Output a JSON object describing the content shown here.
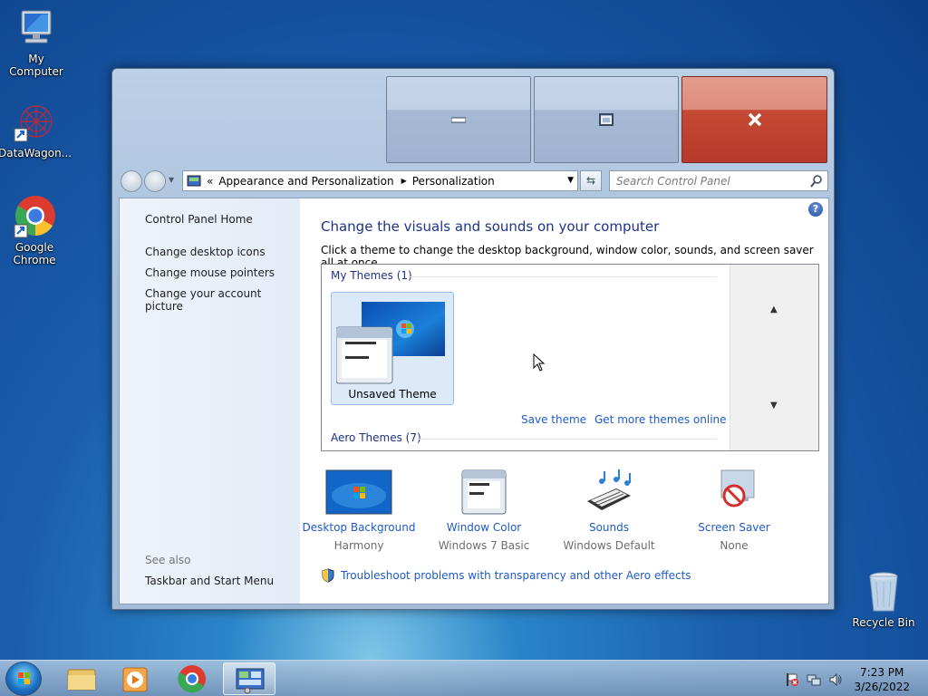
{
  "desktop": {
    "icons": [
      {
        "label": "My Computer"
      },
      {
        "label": "DataWagon..."
      },
      {
        "label": "Google Chrome"
      },
      {
        "label": "Recycle Bin"
      }
    ]
  },
  "window": {
    "caption_buttons": {
      "minimize": "minimize",
      "maximize": "maximize",
      "close": "close"
    },
    "address": {
      "overflow": "«",
      "crumbs": [
        "Appearance and Personalization",
        "Personalization"
      ]
    },
    "search": {
      "placeholder": "Search Control Panel"
    },
    "left_pane": {
      "home": "Control Panel Home",
      "links": [
        "Change desktop icons",
        "Change mouse pointers",
        "Change your account picture"
      ],
      "see_also_label": "See also",
      "see_also_links": [
        "Taskbar and Start Menu"
      ]
    },
    "main": {
      "title": "Change the visuals and sounds on your computer",
      "description": "Click a theme to change the desktop background, window color, sounds, and screen saver all at once.",
      "my_themes_label": "My Themes (1)",
      "selected_theme": "Unsaved Theme",
      "save_theme": "Save theme",
      "get_more": "Get more themes online",
      "aero_label": "Aero Themes (7)",
      "bottom_items": [
        {
          "title": "Desktop Background",
          "sub": "Harmony"
        },
        {
          "title": "Window Color",
          "sub": "Windows 7 Basic"
        },
        {
          "title": "Sounds",
          "sub": "Windows Default"
        },
        {
          "title": "Screen Saver",
          "sub": "None"
        }
      ],
      "troubleshoot": "Troubleshoot problems with transparency and other Aero effects"
    }
  },
  "taskbar": {
    "time": "7:23 PM",
    "date": "3/26/2022"
  },
  "colors": {
    "link": "#1f5bc6",
    "heading": "#1e3287",
    "close": "#c44a35"
  }
}
